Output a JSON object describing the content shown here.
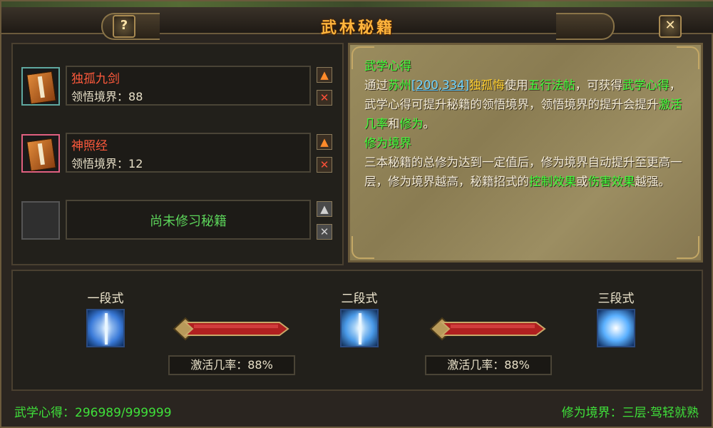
{
  "window": {
    "title": "武林秘籍",
    "help_label": "?",
    "close_label": "✕"
  },
  "books": [
    {
      "name": "独孤九剑",
      "level_label": "领悟境界：",
      "level": "88",
      "icon": "book-orange-icon",
      "frame_color": "#5fa8a0"
    },
    {
      "name": "神照经",
      "level_label": "领悟境界：",
      "level": "12",
      "icon": "book-orange-icon",
      "frame_color": "#e06080"
    }
  ],
  "empty_slot": {
    "text": "尚未修习秘籍"
  },
  "controls": {
    "up": "▲",
    "delete": "✕"
  },
  "scroll": {
    "heading1": "武学心得",
    "p1_a": "通过",
    "p1_place": "苏州",
    "p1_coord": "[200,334]",
    "p1_npc": "独孤悔",
    "p1_b": "使用",
    "p1_item": "五行法帖",
    "p1_c": "，可获得",
    "p1_term": "武学心得",
    "p1_d": "，武学心得可提升秘籍的领悟境界，领悟境界的提升会提升",
    "p1_rate": "激活几率",
    "p1_e": "和",
    "p1_cult": "修为",
    "p1_f": "。",
    "heading2": "修为境界",
    "p2_a": "三本秘籍的总修为达到一定值后，修为境界自动提升至更高一层，修为境界越高，秘籍招式的",
    "p2_ctrl": "控制效果",
    "p2_b": "或",
    "p2_dmg": "伤害效果",
    "p2_c": "越强。"
  },
  "stages": [
    {
      "label": "一段式",
      "icon": "sword-skill-icon"
    },
    {
      "label": "二段式",
      "icon": "sword-burst-icon"
    },
    {
      "label": "三段式",
      "icon": "figure-burst-icon"
    }
  ],
  "rates": [
    {
      "label": "激活几率：",
      "value": "88%"
    },
    {
      "label": "激活几率：",
      "value": "88%"
    }
  ],
  "status": {
    "left_label": "武学心得：",
    "left_value": "296989/999999",
    "right_label": "修为境界：",
    "right_value": "三层·驾轻就熟"
  },
  "colors": {
    "title": "#ffb43c",
    "highlight_green": "#3fff3a",
    "highlight_yellow": "#ffd030",
    "book_name_red": "#ff5a3c"
  }
}
